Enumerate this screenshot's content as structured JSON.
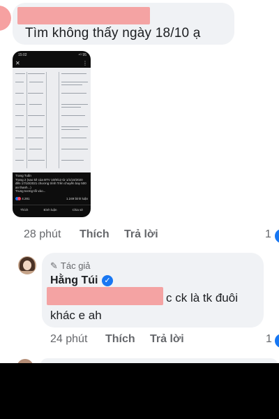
{
  "comment1": {
    "text": "Tìm không thấy ngày 18/10 ạ"
  },
  "phone": {
    "status_time": "15:02",
    "status_right": "⁴ᴳ 95",
    "caption": "Trang Tuấn\nTrang 2 (sao kê của BTV 10/9/12 từ 1/1/10/2020 đến 17/10/2021 chương trình Trên chuyến bay 500 an thanh...)\nTrung tương tối vào...",
    "reaction_count": "4.281",
    "comment_count": "1.249 bình luận",
    "actions": [
      "Thích",
      "Bình luận",
      "Chia sẻ"
    ]
  },
  "comment1_actions": {
    "time": "28 phút",
    "like": "Thích",
    "reply": "Trả lời",
    "reaction_count": "1"
  },
  "reply": {
    "author_tag": "Tác giả",
    "author_name": "Hằng Túi",
    "line1": "c ck là tk đuôi",
    "line2": "khác e ah"
  },
  "reply_actions": {
    "time": "24 phút",
    "like": "Thích",
    "reply": "Trả lời",
    "reaction_count": "1"
  },
  "colors": {
    "accent": "#1877f2",
    "bubble": "#f0f2f5",
    "redaction": "#f4a3a3",
    "muted": "#65676b"
  }
}
